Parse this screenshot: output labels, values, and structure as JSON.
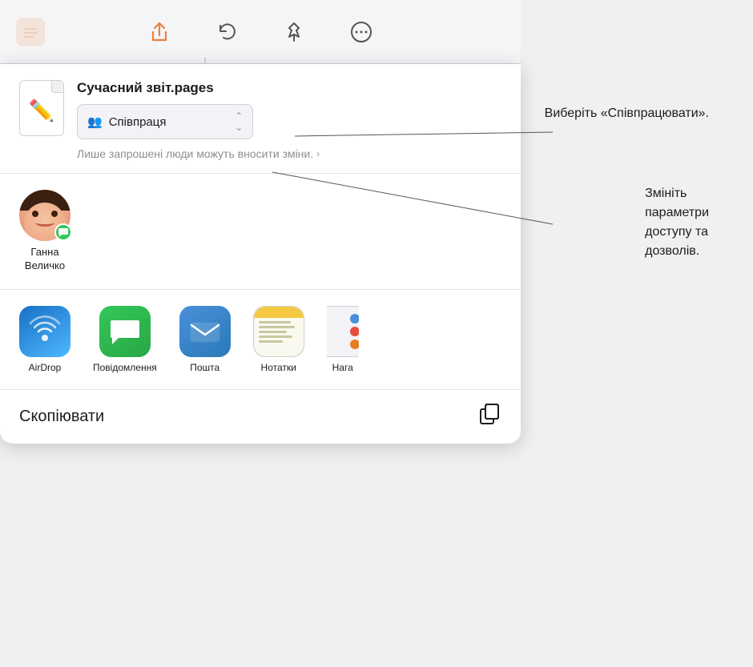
{
  "toolbar": {
    "icons": [
      "share",
      "undo",
      "pin",
      "more"
    ]
  },
  "file": {
    "name": "Сучасний звіт.pages",
    "dropdown_label": "Співпраця",
    "access_text": "Лише запрошені люди можуть вносити зміни."
  },
  "contacts": [
    {
      "name": "Ганна\nВеличко",
      "app": "Messages"
    }
  ],
  "apps": [
    {
      "label": "AirDrop",
      "type": "airdrop"
    },
    {
      "label": "Повідомлення",
      "type": "messages"
    },
    {
      "label": "Пошта",
      "type": "mail"
    },
    {
      "label": "Нотатки",
      "type": "notes"
    },
    {
      "label": "Нага",
      "type": "reminders"
    }
  ],
  "actions": [
    {
      "label": "Скопіювати",
      "icon": "copy"
    }
  ],
  "callouts": [
    {
      "text": "Виберіть\n«Співпрацювати».",
      "id": 1
    },
    {
      "text": "Змініть\nпараметри\nдоступу та\ndозволів.",
      "id": 2
    }
  ]
}
